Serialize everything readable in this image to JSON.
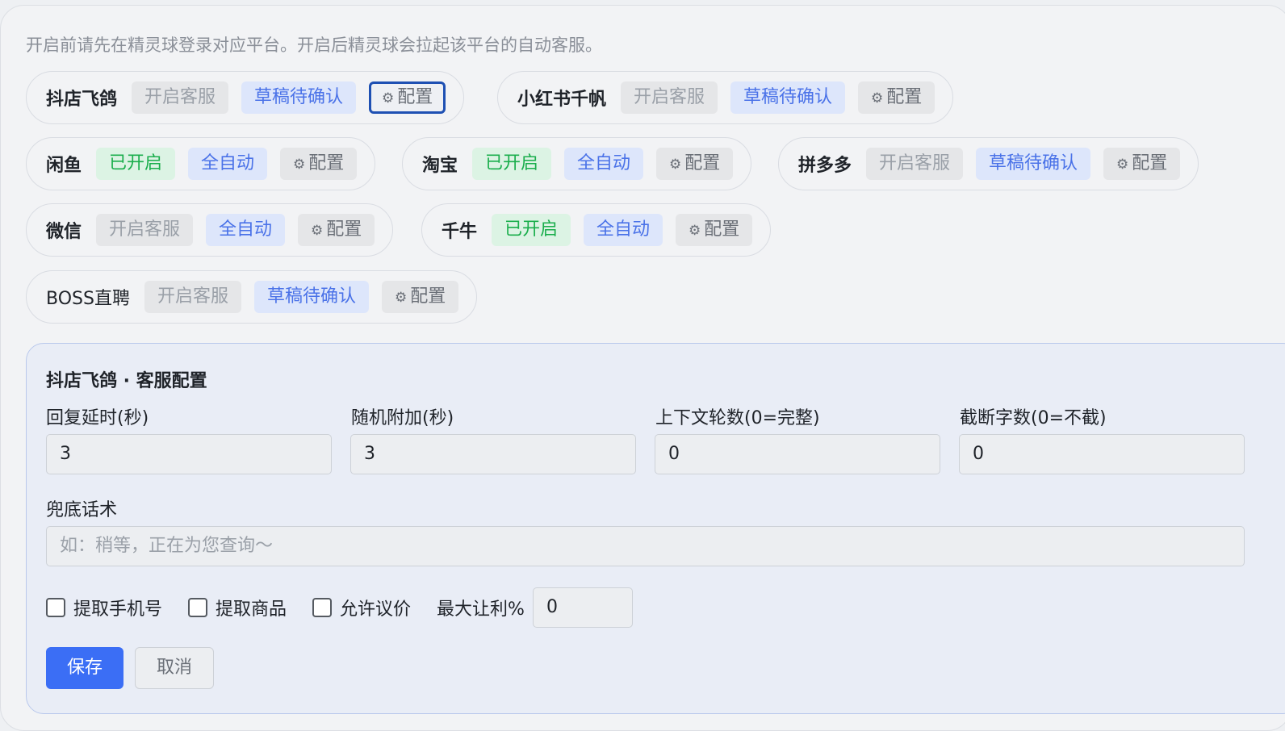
{
  "hint": "开启前请先在精灵球登录对应平台。开启后精灵球会拉起该平台的自动客服。",
  "gear_icon": "⚙",
  "platforms": [
    {
      "name": "抖店飞鸽",
      "status": "开启客服",
      "mode": "草稿待确认",
      "config": "配置"
    },
    {
      "name": "小红书千帆",
      "status": "开启客服",
      "mode": "草稿待确认",
      "config": "配置"
    },
    {
      "name": "闲鱼",
      "status": "已开启",
      "mode": "全自动",
      "config": "配置"
    },
    {
      "name": "淘宝",
      "status": "已开启",
      "mode": "全自动",
      "config": "配置"
    },
    {
      "name": "拼多多",
      "status": "开启客服",
      "mode": "草稿待确认",
      "config": "配置"
    },
    {
      "name": "微信",
      "status": "开启客服",
      "mode": "全自动",
      "config": "配置"
    },
    {
      "name": "千牛",
      "status": "已开启",
      "mode": "全自动",
      "config": "配置"
    },
    {
      "name": "BOSS直聘",
      "status": "开启客服",
      "mode": "草稿待确认",
      "config": "配置"
    }
  ],
  "config_panel": {
    "title": "抖店飞鸽 · 客服配置",
    "fields": [
      {
        "label": "回复延时(秒)",
        "value": "3"
      },
      {
        "label": "随机附加(秒)",
        "value": "3"
      },
      {
        "label": "上下文轮数(0=完整)",
        "value": "0"
      },
      {
        "label": "截断字数(0=不截)",
        "value": "0"
      }
    ],
    "fallback_label": "兜底话术",
    "fallback_placeholder": "如：稍等，正在为您查询～",
    "checkboxes": [
      "提取手机号",
      "提取商品",
      "允许议价"
    ],
    "max_discount_label": "最大让利%",
    "max_discount_value": "0",
    "save_label": "保存",
    "cancel_label": "取消"
  },
  "colors": {
    "accent": "#3b6ef5",
    "enabled_green": "#1aae4c",
    "mode_blue": "#4a72e8",
    "active_border": "#1e50b3"
  }
}
